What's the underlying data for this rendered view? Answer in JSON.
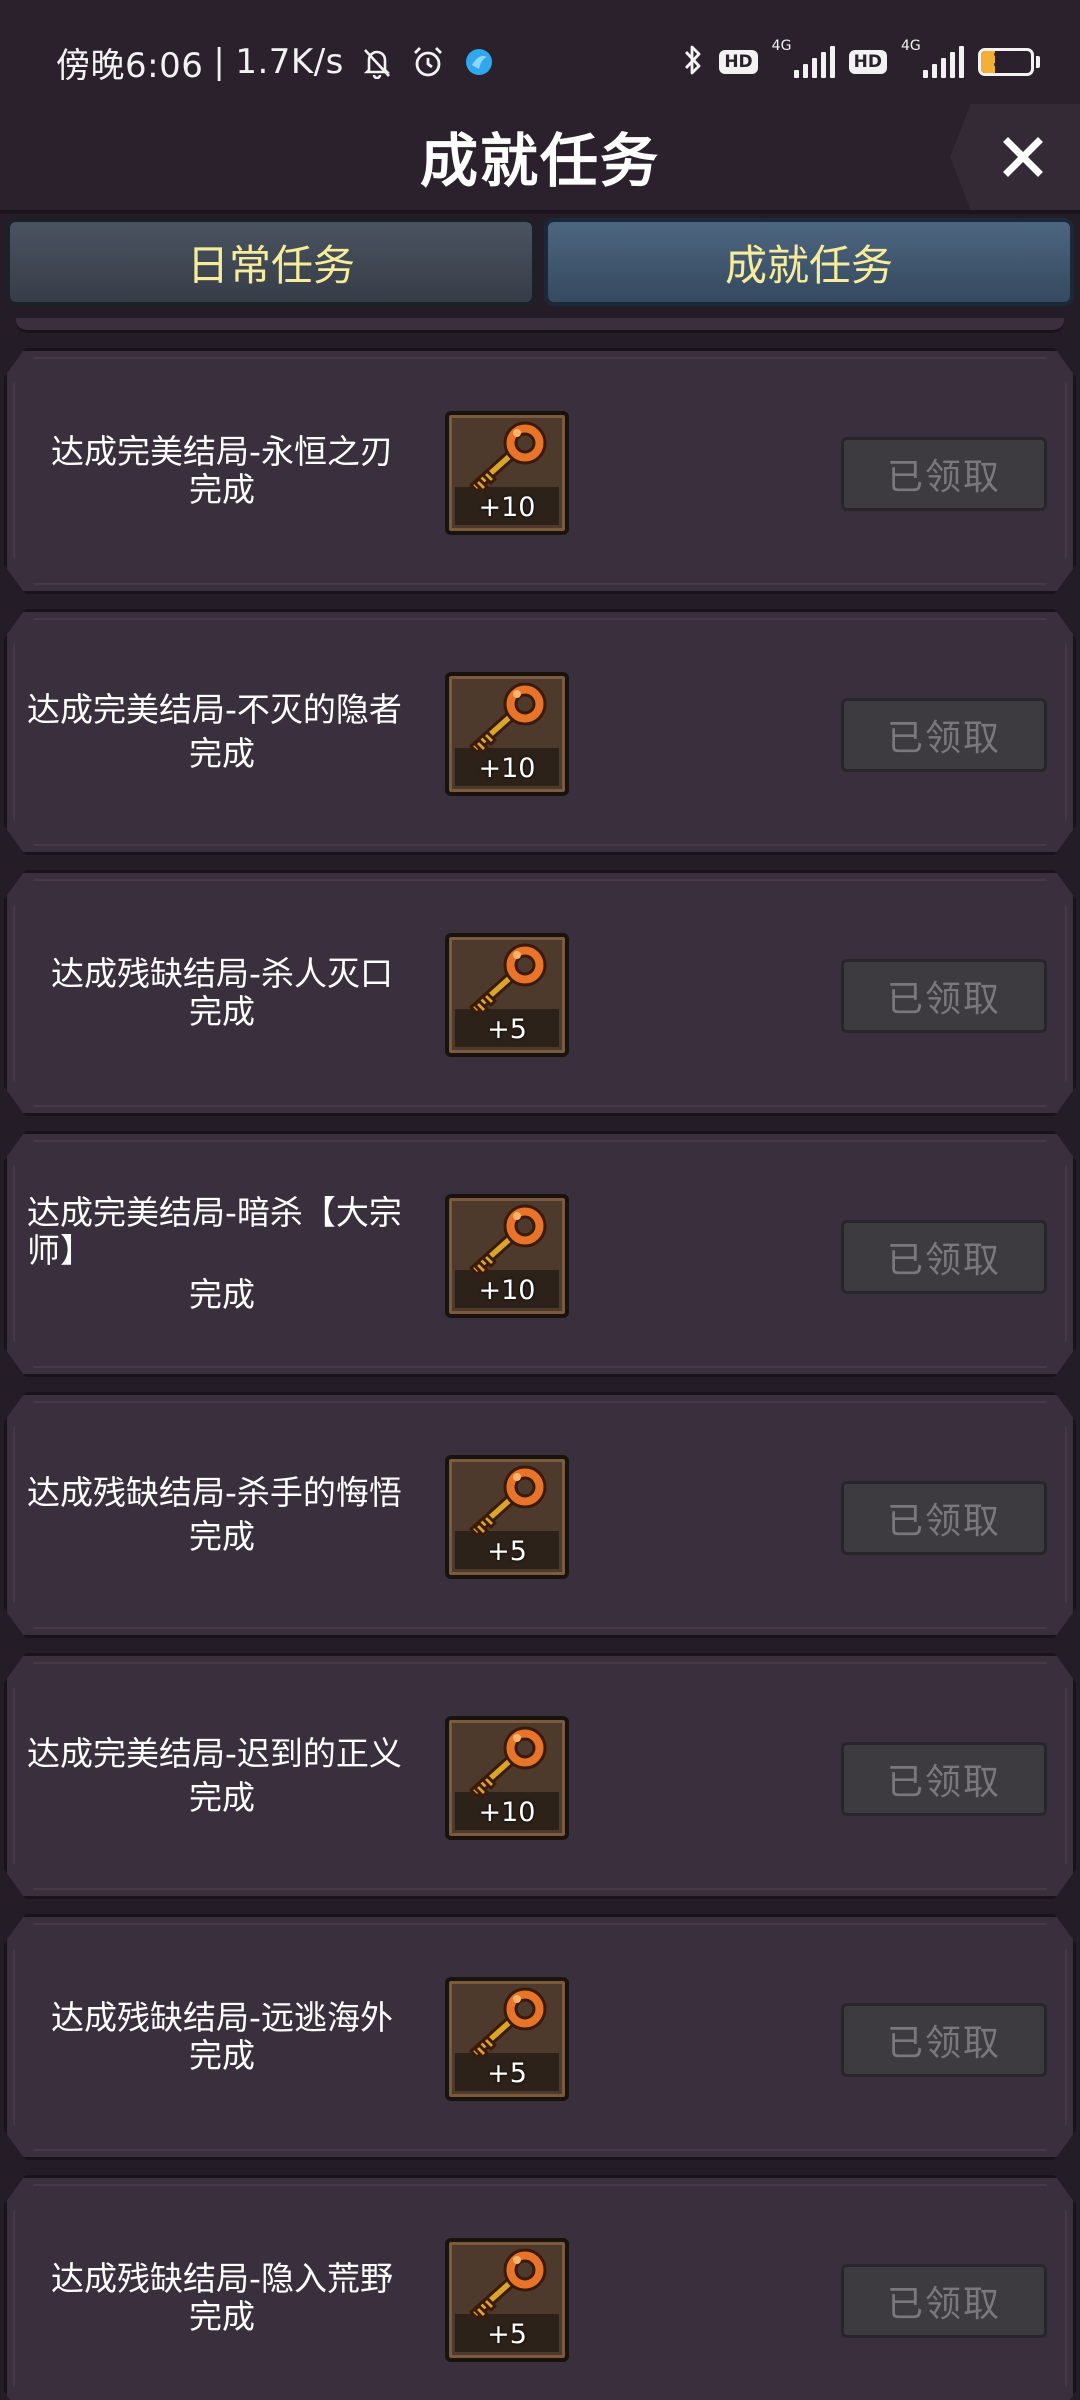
{
  "status_bar": {
    "time": "傍晚6:06",
    "separator": "|",
    "speed": "1.7K/s",
    "hd1": "HD",
    "net1": "4G",
    "hd2": "HD",
    "net2": "4G",
    "battery": "27",
    "battery_level_percent": 27,
    "battery_color": "#f2b134"
  },
  "header": {
    "title": "成就任务",
    "close_icon": "close-icon"
  },
  "tabs": [
    {
      "label": "日常任务",
      "active": false
    },
    {
      "label": "成就任务",
      "active": true
    }
  ],
  "tasks": [
    {
      "name": "达成完美结局-永恒之刃",
      "state": "完成",
      "reward": "+10",
      "button": "已领取"
    },
    {
      "name": "达成完美结局-不灭的隐者",
      "state": "完成",
      "reward": "+10",
      "button": "已领取"
    },
    {
      "name": "达成残缺结局-杀人灭口",
      "state": "完成",
      "reward": "+5",
      "button": "已领取"
    },
    {
      "name": "达成完美结局-暗杀【大宗师】",
      "state": "完成",
      "reward": "+10",
      "button": "已领取"
    },
    {
      "name": "达成残缺结局-杀手的悔悟",
      "state": "完成",
      "reward": "+5",
      "button": "已领取"
    },
    {
      "name": "达成完美结局-迟到的正义",
      "state": "完成",
      "reward": "+10",
      "button": "已领取"
    },
    {
      "name": "达成残缺结局-远逃海外",
      "state": "完成",
      "reward": "+5",
      "button": "已领取"
    },
    {
      "name": "达成残缺结局-隐入荒野",
      "state": "完成",
      "reward": "+5",
      "button": "已领取"
    }
  ],
  "colors": {
    "background": "#241d27",
    "card": "#3a2f3d",
    "tab_text": "#f6ec9a",
    "key": "#e8742a",
    "claimed_text": "#7a787c"
  }
}
